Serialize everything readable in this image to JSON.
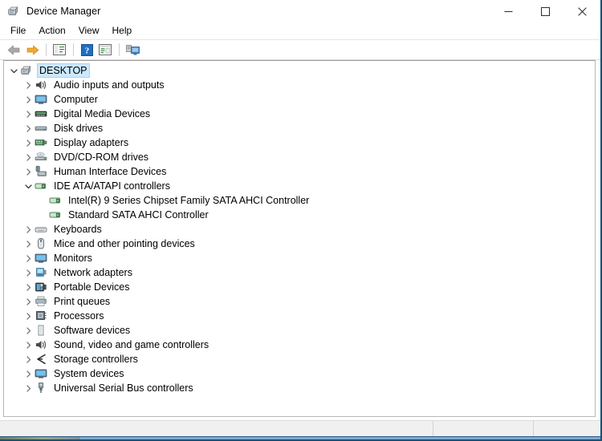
{
  "window": {
    "title": "Device Manager",
    "app_icon": "device-manager-icon",
    "border_color": "#1d4f70",
    "controls": [
      {
        "name": "minimize",
        "label": "Minimize",
        "glyph": "minimize-icon"
      },
      {
        "name": "maximize",
        "label": "Maximize",
        "glyph": "maximize-icon"
      },
      {
        "name": "close",
        "label": "Close",
        "glyph": "close-icon"
      }
    ]
  },
  "menubar": {
    "items": [
      {
        "label": "File"
      },
      {
        "label": "Action"
      },
      {
        "label": "View"
      },
      {
        "label": "Help"
      }
    ]
  },
  "toolbar": {
    "buttons": [
      {
        "name": "back-button",
        "icon": "arrow-left-icon",
        "tooltip": "Back"
      },
      {
        "name": "forward-button",
        "icon": "arrow-right-icon",
        "tooltip": "Forward"
      },
      {
        "name": "separator-1",
        "icon": "separator"
      },
      {
        "name": "show-hide-console-tree-button",
        "icon": "console-tree-icon",
        "tooltip": "Show/Hide Console Tree"
      },
      {
        "name": "separator-2",
        "icon": "separator"
      },
      {
        "name": "help-button",
        "icon": "help-question-icon",
        "tooltip": "Help"
      },
      {
        "name": "properties-button",
        "icon": "properties-icon",
        "tooltip": "Properties"
      },
      {
        "name": "separator-3",
        "icon": "separator"
      },
      {
        "name": "scan-for-hardware-changes-button",
        "icon": "scan-hardware-icon",
        "tooltip": "Scan for hardware changes"
      }
    ]
  },
  "tree": {
    "selected_label": "DESKTOP",
    "selection_color": "#cce8ff",
    "nodes": [
      {
        "label": "DESKTOP",
        "level": 0,
        "icon": "computer-root-icon",
        "state": "expanded",
        "selected": true
      },
      {
        "label": "Audio inputs and outputs",
        "level": 1,
        "icon": "speaker-icon",
        "state": "collapsed",
        "selected": false
      },
      {
        "label": "Computer",
        "level": 1,
        "icon": "monitor-icon",
        "state": "collapsed",
        "selected": false
      },
      {
        "label": "Digital Media Devices",
        "level": 1,
        "icon": "media-device-icon",
        "state": "collapsed",
        "selected": false
      },
      {
        "label": "Disk drives",
        "level": 1,
        "icon": "disk-drive-icon",
        "state": "collapsed",
        "selected": false
      },
      {
        "label": "Display adapters",
        "level": 1,
        "icon": "display-adapter-icon",
        "state": "collapsed",
        "selected": false
      },
      {
        "label": "DVD/CD-ROM drives",
        "level": 1,
        "icon": "optical-drive-icon",
        "state": "collapsed",
        "selected": false
      },
      {
        "label": "Human Interface Devices",
        "level": 1,
        "icon": "hid-icon",
        "state": "collapsed",
        "selected": false
      },
      {
        "label": "IDE ATA/ATAPI controllers",
        "level": 1,
        "icon": "ide-controller-icon",
        "state": "expanded",
        "selected": false
      },
      {
        "label": "Intel(R) 9 Series Chipset Family SATA AHCI Controller",
        "level": 2,
        "icon": "ide-controller-icon",
        "state": "leaf",
        "selected": false
      },
      {
        "label": "Standard SATA AHCI Controller",
        "level": 2,
        "icon": "ide-controller-icon",
        "state": "leaf",
        "selected": false
      },
      {
        "label": "Keyboards",
        "level": 1,
        "icon": "keyboard-icon",
        "state": "collapsed",
        "selected": false
      },
      {
        "label": "Mice and other pointing devices",
        "level": 1,
        "icon": "mouse-icon",
        "state": "collapsed",
        "selected": false
      },
      {
        "label": "Monitors",
        "level": 1,
        "icon": "monitor-icon",
        "state": "collapsed",
        "selected": false
      },
      {
        "label": "Network adapters",
        "level": 1,
        "icon": "network-adapter-icon",
        "state": "collapsed",
        "selected": false
      },
      {
        "label": "Portable Devices",
        "level": 1,
        "icon": "portable-device-icon",
        "state": "collapsed",
        "selected": false
      },
      {
        "label": "Print queues",
        "level": 1,
        "icon": "printer-icon",
        "state": "collapsed",
        "selected": false
      },
      {
        "label": "Processors",
        "level": 1,
        "icon": "processor-icon",
        "state": "collapsed",
        "selected": false
      },
      {
        "label": "Software devices",
        "level": 1,
        "icon": "software-device-icon",
        "state": "collapsed",
        "selected": false
      },
      {
        "label": "Sound, video and game controllers",
        "level": 1,
        "icon": "speaker-icon",
        "state": "collapsed",
        "selected": false
      },
      {
        "label": "Storage controllers",
        "level": 1,
        "icon": "storage-controller-icon",
        "state": "collapsed",
        "selected": false
      },
      {
        "label": "System devices",
        "level": 1,
        "icon": "monitor-icon",
        "state": "collapsed",
        "selected": false
      },
      {
        "label": "Universal Serial Bus controllers",
        "level": 1,
        "icon": "usb-icon",
        "state": "collapsed",
        "selected": false
      }
    ]
  },
  "statusbar": {
    "panels": [
      {
        "name": "status-main",
        "text": ""
      },
      {
        "name": "status-second",
        "text": ""
      },
      {
        "name": "status-third",
        "text": ""
      }
    ]
  }
}
